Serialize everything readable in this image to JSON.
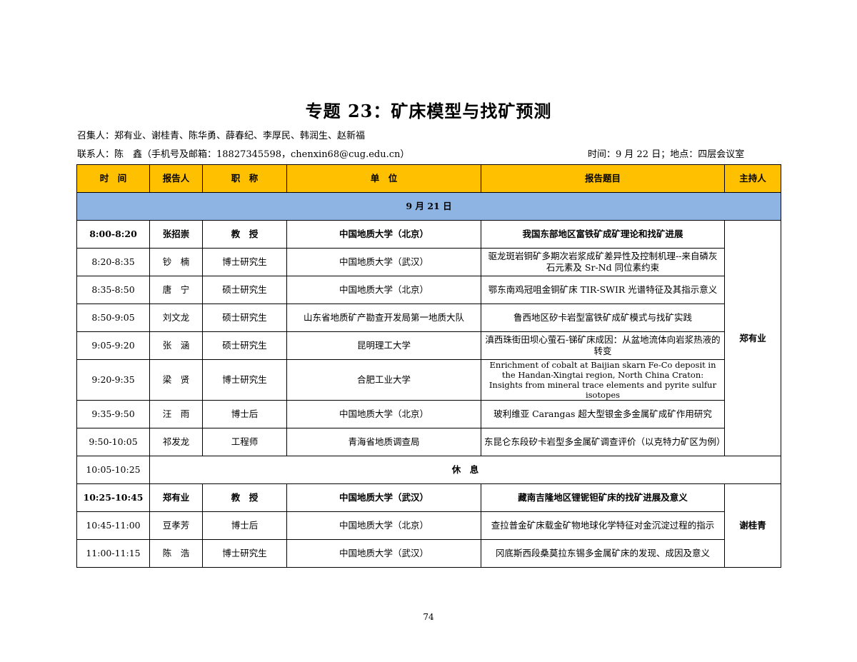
{
  "title": "专题 23：矿床模型与找矿预测",
  "conveners": "召集人：郑有业、谢桂青、陈华勇、薛春纪、李厚民、韩润生、赵新福",
  "contact": "联系人：陈　鑫（手机号及邮箱：18827345598，chenxin68@cug.edu.cn）",
  "time_place": "时间：9 月 22 日；地点：四层会议室",
  "headers": {
    "time": "时　间",
    "speaker": "报告人",
    "position": "职　称",
    "unit": "单　位",
    "topic": "报告题目",
    "host": "主持人"
  },
  "date_row": "9 月 21 日",
  "break_row": {
    "time": "10:05-10:25",
    "label": "休　息"
  },
  "rows1": [
    {
      "time": "8:00-8:20",
      "speaker": "张招崇",
      "position": "教　授",
      "unit": "中国地质大学（北京）",
      "topic": "我国东部地区富铁矿成矿理论和找矿进展"
    },
    {
      "time": "8:20-8:35",
      "speaker": "钞　楠",
      "position": "博士研究生",
      "unit": "中国地质大学（武汉）",
      "topic": "驱龙斑岩铜矿多期次岩浆成矿差异性及控制机理--来自磷灰石元素及 Sr-Nd 同位素约束"
    },
    {
      "time": "8:35-8:50",
      "speaker": "唐　宁",
      "position": "硕士研究生",
      "unit": "中国地质大学（北京）",
      "topic": "鄂东南鸡冠咀金铜矿床 TIR-SWIR 光谱特征及其指示意义"
    },
    {
      "time": "8:50-9:05",
      "speaker": "刘文龙",
      "position": "硕士研究生",
      "unit": "山东省地质矿产勘查开发局第一地质大队",
      "topic": "鲁西地区矽卡岩型富铁矿成矿模式与找矿实践"
    },
    {
      "time": "9:05-9:20",
      "speaker": "张　涵",
      "position": "硕士研究生",
      "unit": "昆明理工大学",
      "topic": "滇西珠街田坝心萤石-锑矿床成因：从盆地流体向岩浆热液的转变"
    },
    {
      "time": "9:20-9:35",
      "speaker": "梁　贤",
      "position": "博士研究生",
      "unit": "合肥工业大学",
      "topic": "Enrichment of cobalt at Baijian skarn Fe-Co deposit in the Handan-Xingtai region, North China Craton: Insights from mineral trace elements and pyrite sulfur isotopes"
    },
    {
      "time": "9:35-9:50",
      "speaker": "汪　雨",
      "position": "博士后",
      "unit": "中国地质大学（北京）",
      "topic": "玻利维亚 Carangas 超大型银金多金属矿成矿作用研究"
    },
    {
      "time": "9:50-10:05",
      "speaker": "祁发龙",
      "position": "工程师",
      "unit": "青海省地质调查局",
      "topic": "东昆仑东段矽卡岩型多金属矿调查评价（以克特力矿区为例）"
    }
  ],
  "host1": "郑有业",
  "rows2": [
    {
      "time": "10:25-10:45",
      "speaker": "郑有业",
      "position": "教　授",
      "unit": "中国地质大学（武汉）",
      "topic": "藏南吉隆地区锂铌钽矿床的找矿进展及意义"
    },
    {
      "time": "10:45-11:00",
      "speaker": "豆孝芳",
      "position": "博士后",
      "unit": "中国地质大学（北京）",
      "topic": "查拉普金矿床载金矿物地球化学特征对金沉淀过程的指示"
    },
    {
      "time": "11:00-11:15",
      "speaker": "陈　浩",
      "position": "博士研究生",
      "unit": "中国地质大学（武汉）",
      "topic": "冈底斯西段桑莫拉东锡多金属矿床的发现、成因及意义"
    }
  ],
  "host2": "谢桂青",
  "page_number": "74"
}
